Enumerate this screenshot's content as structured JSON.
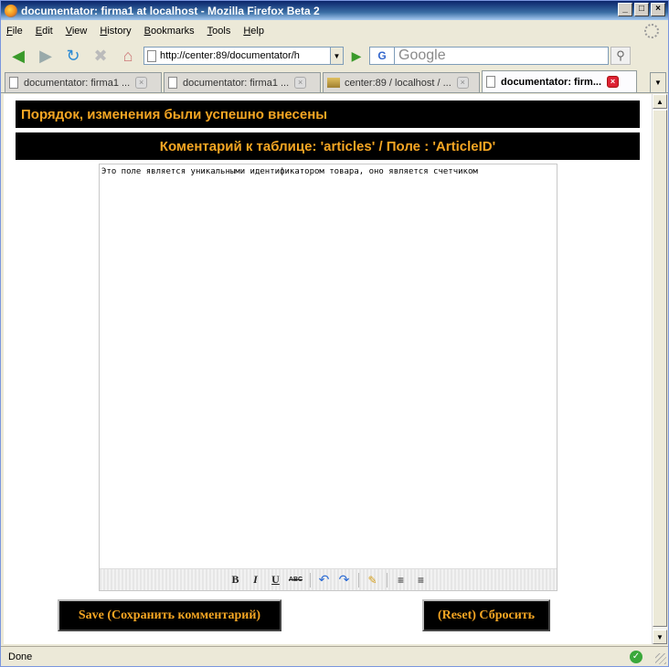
{
  "window": {
    "title": "documentator: firma1 at localhost - Mozilla Firefox Beta 2",
    "buttons": [
      "_",
      "□",
      "×"
    ]
  },
  "menu": [
    "File",
    "Edit",
    "View",
    "History",
    "Bookmarks",
    "Tools",
    "Help"
  ],
  "navbar": {
    "url": "http://center:89/documentator/h",
    "search_engine": "G",
    "search_placeholder": "Google"
  },
  "tabs": [
    {
      "label": "documentator: firma1 ...",
      "icon": "page-icon",
      "active": false
    },
    {
      "label": "documentator: firma1 ...",
      "icon": "page-icon",
      "active": false
    },
    {
      "label": "center:89 / localhost / ...",
      "icon": "phpmyadmin-icon",
      "active": false
    },
    {
      "label": "documentator: firm...",
      "icon": "page-icon",
      "active": true
    }
  ],
  "content": {
    "success_message": "Порядок, изменения были успешно внесены",
    "comment_title": "Коментарий к таблице: 'articles' / Поле : 'ArticleID'",
    "editor_text": "Это поле является уникальными идентификатором товара, оно является счетчиком",
    "toolbar": {
      "bold": "B",
      "italic": "I",
      "underline": "U",
      "strike": "ABC"
    },
    "save_button": "Save (Сохранить комментарий)",
    "reset_button": "(Reset) Сбросить"
  },
  "status": {
    "text": "Done"
  },
  "colors": {
    "banner_bg": "#000000",
    "banner_text": "#f5a623"
  }
}
